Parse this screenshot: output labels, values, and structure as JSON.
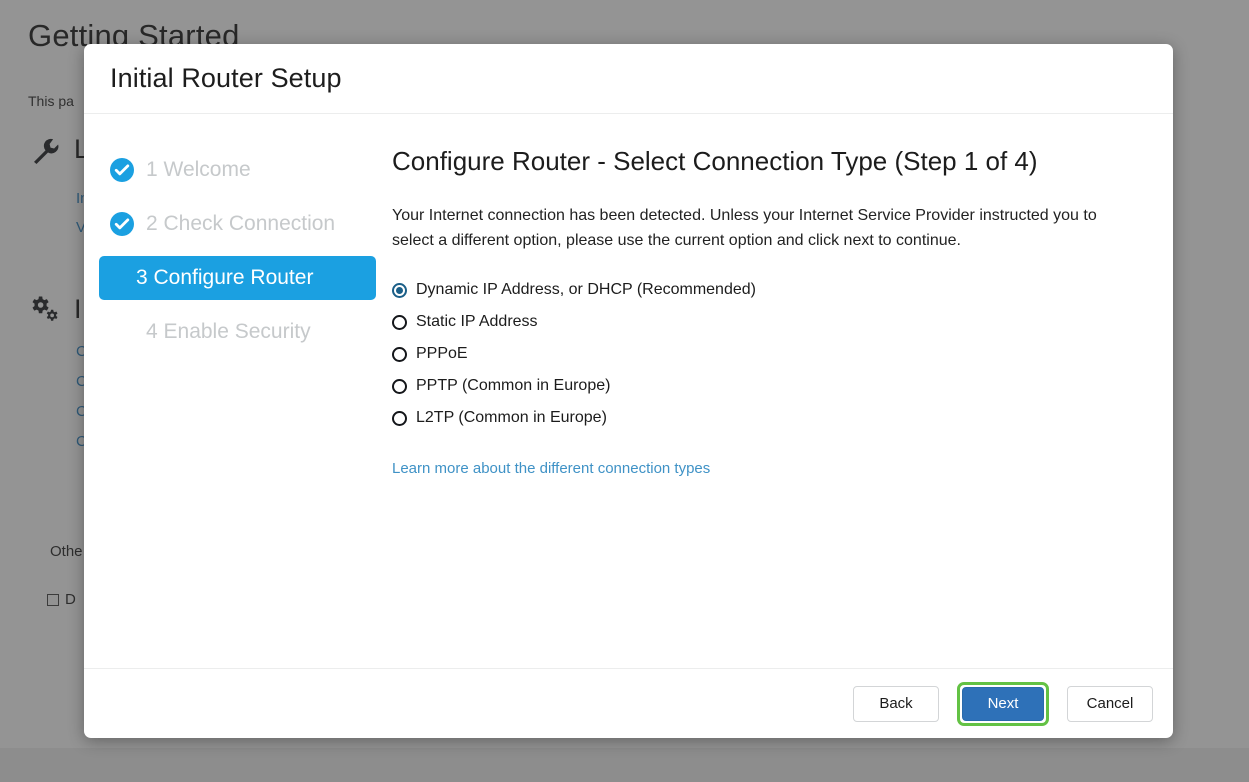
{
  "background": {
    "title": "Getting Started",
    "intro": "This pa",
    "sections": [
      {
        "icon": "wrench-icon",
        "label": "L"
      },
      {
        "icon": "gears-icon",
        "label": "I"
      }
    ],
    "links_group_1": [
      "In",
      "V"
    ],
    "links_group_2": [
      "C",
      "C",
      "C",
      "C"
    ],
    "other_label": "Othe",
    "checkbox_label": "D",
    "overlay_color": "#3c3c3c"
  },
  "modal": {
    "title": "Initial Router Setup",
    "steps": [
      {
        "number": "1",
        "label": "1 Welcome",
        "state": "done"
      },
      {
        "number": "2",
        "label": "2 Check Connection",
        "state": "done"
      },
      {
        "number": "3",
        "label": "3 Configure Router",
        "state": "active"
      },
      {
        "number": "4",
        "label": "4 Enable Security",
        "state": "pending"
      }
    ],
    "pane": {
      "title": "Configure Router - Select Connection Type (Step 1 of 4)",
      "description": "Your Internet connection has been detected. Unless your Internet Service Provider instructed you to select a different option, please use the current option and click next to continue.",
      "options": [
        {
          "label": "Dynamic IP Address, or DHCP (Recommended)",
          "selected": true
        },
        {
          "label": "Static IP Address",
          "selected": false
        },
        {
          "label": "PPPoE",
          "selected": false
        },
        {
          "label": "PPTP (Common in Europe)",
          "selected": false
        },
        {
          "label": "L2TP (Common in Europe)",
          "selected": false
        }
      ],
      "learn_more_link": "Learn more about the different connection types"
    },
    "footer": {
      "back_label": "Back",
      "next_label": "Next",
      "cancel_label": "Cancel"
    },
    "colors": {
      "active_step": "#1ba0e1",
      "done_badge": "#1ba0e1",
      "next_button_fill": "#2e71b8",
      "next_button_highlight": "#63c244",
      "link": "#3f92c6",
      "radio_selected": "#1b5f88"
    }
  }
}
